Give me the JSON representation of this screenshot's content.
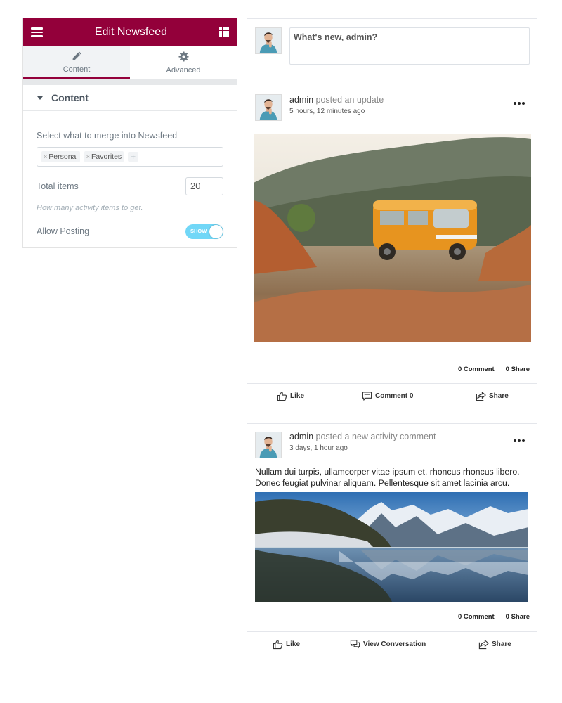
{
  "editor": {
    "title": "Edit Newsfeed",
    "tabs": [
      {
        "label": "Content",
        "icon": "pencil-icon",
        "active": true
      },
      {
        "label": "Advanced",
        "icon": "gear-icon",
        "active": false
      }
    ],
    "section_title": "Content",
    "merge_label": "Select what to merge into Newsfeed",
    "merge_tags": [
      "Personal",
      "Favorites"
    ],
    "tag_remove_symbol": "×",
    "add_symbol": "+",
    "total_items_label": "Total items",
    "total_items_value": "20",
    "total_items_hint": "How many activity items to get.",
    "allow_posting_label": "Allow Posting",
    "allow_posting_toggle": "SHOW",
    "accent_color": "#93003a"
  },
  "composer": {
    "placeholder": "What's new, admin?"
  },
  "posts": [
    {
      "user": "admin",
      "action": "posted an update",
      "time": "5 hours, 12 minutes ago",
      "comment_count": "0 Comment",
      "share_count": "0 Share",
      "actions": [
        "Like",
        "Comment 0",
        "Share"
      ]
    },
    {
      "user": "admin",
      "action": "posted a new activity comment",
      "time": "3 days, 1 hour ago",
      "text": "Nullam dui turpis, ullamcorper vitae ipsum et, rhoncus rhoncus libero. Donec feugiat pulvinar aliquam. Pellentesque sit amet lacinia arcu.",
      "comment_count": "0 Comment",
      "share_count": "0 Share",
      "actions": [
        "Like",
        "View Conversation",
        "Share"
      ]
    }
  ]
}
